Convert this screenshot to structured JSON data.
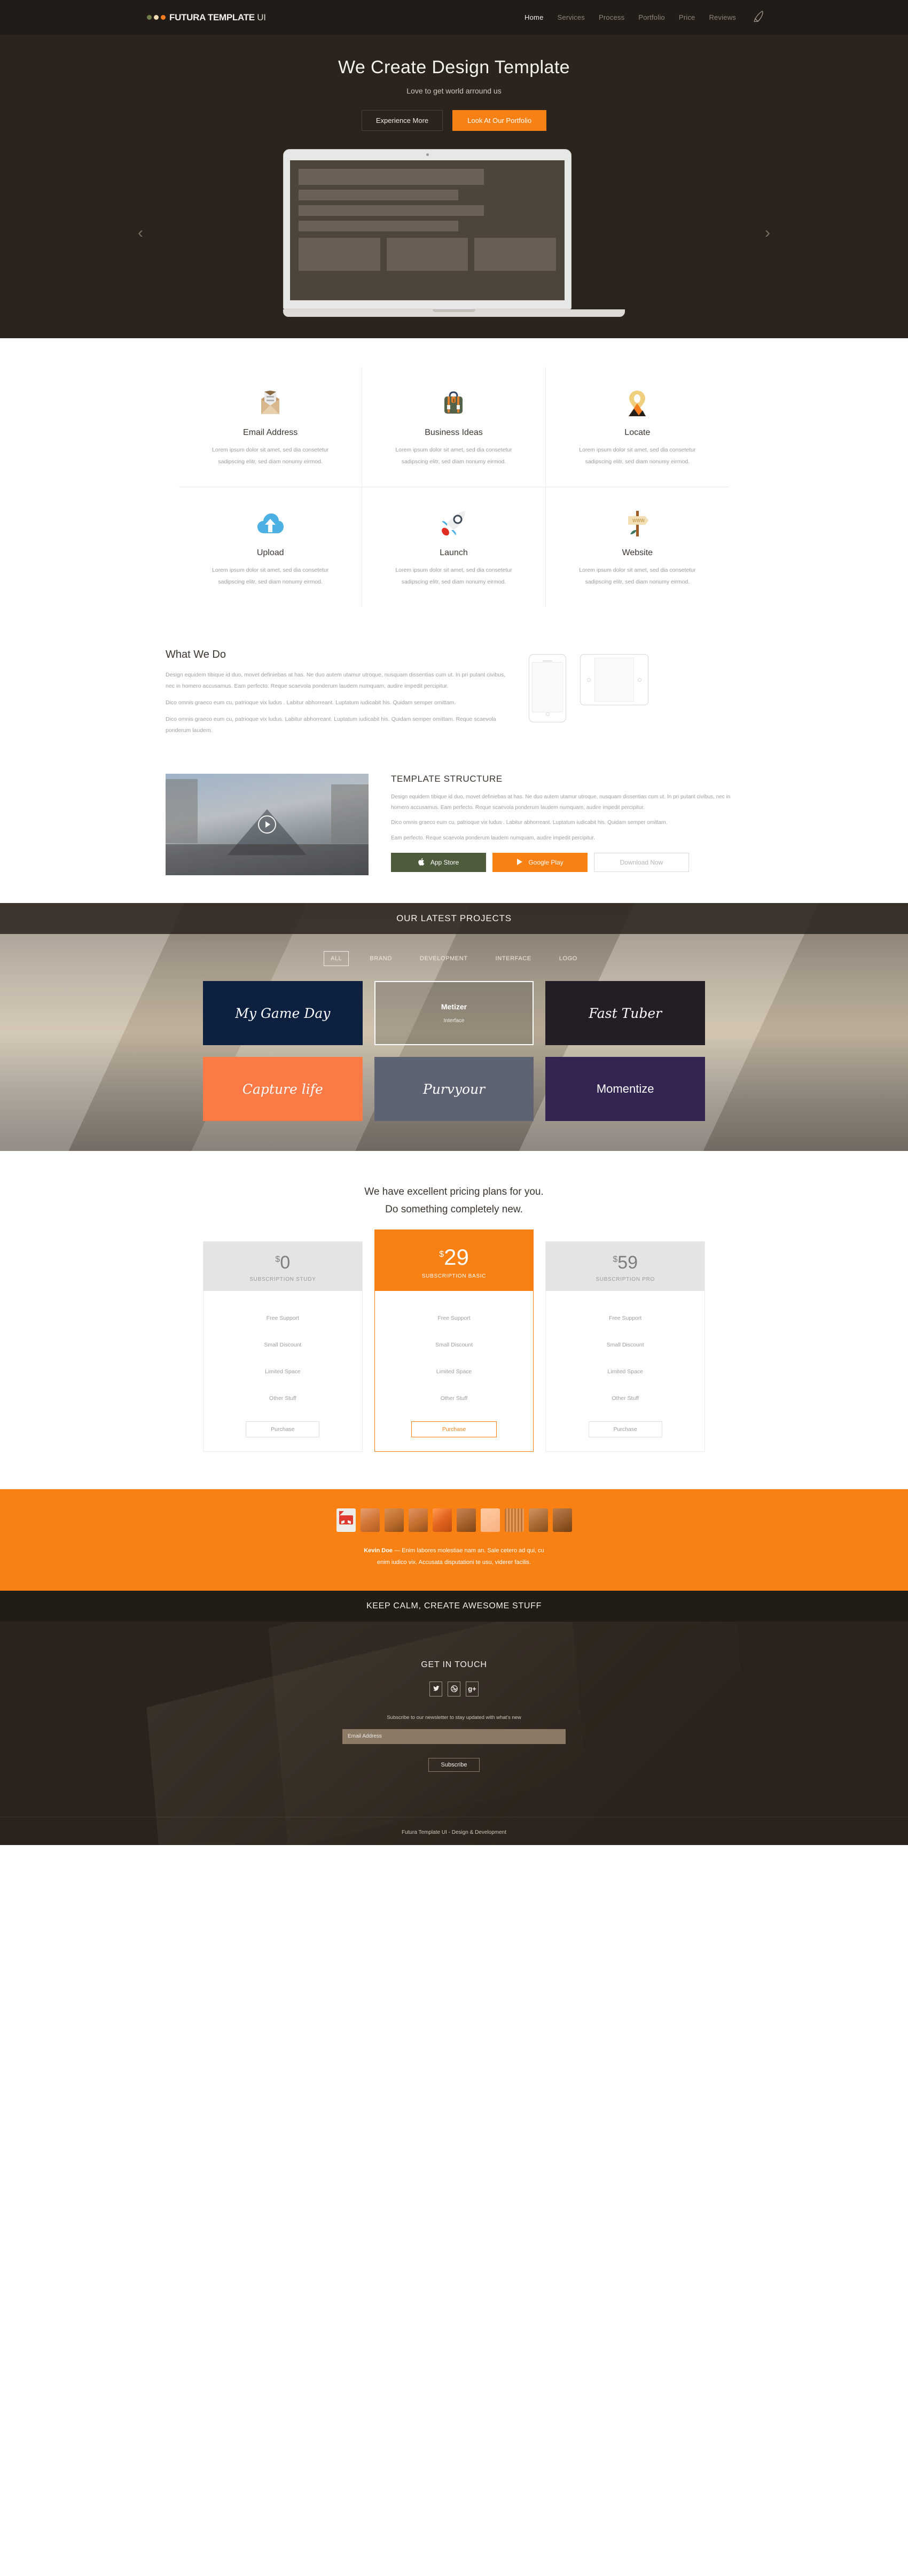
{
  "nav": {
    "brand": "FUTURA TEMPLATE",
    "brand_suffix": "UI",
    "links": [
      {
        "label": "Home",
        "active": true
      },
      {
        "label": "Services",
        "active": false
      },
      {
        "label": "Process",
        "active": false
      },
      {
        "label": "Portfolio",
        "active": false
      },
      {
        "label": "Price",
        "active": false
      },
      {
        "label": "Reviews",
        "active": false
      }
    ],
    "rocket_icon": "rocket-icon"
  },
  "hero": {
    "title": "We Create Design Template",
    "subtitle": "Love to get world arround us",
    "btn_ghost": "Experience More",
    "btn_primary": "Look At Our Portfolio",
    "arrow_prev": "‹",
    "arrow_next": "›"
  },
  "services": {
    "items": [
      {
        "icon": "envelope-icon",
        "title": "Email Address",
        "desc_line1": "Lorem ipsum dolor sit amet,  sed dia  consetetur",
        "desc_line2": "sadipscing elitr, sed diam nonumy eirmod."
      },
      {
        "icon": "briefcase-icon",
        "title": "Business Ideas",
        "desc_line1": "Lorem ipsum dolor sit amet,  sed dia  consetetur",
        "desc_line2": "sadipscing elitr, sed diam nonumy eirmod."
      },
      {
        "icon": "map-pin-icon",
        "title": "Locate",
        "desc_line1": "Lorem ipsum dolor sit amet,  sed dia  consetetur",
        "desc_line2": "sadipscing elitr, sed diam nonumy eirmod."
      },
      {
        "icon": "cloud-upload-icon",
        "title": "Upload",
        "desc_line1": "Lorem ipsum dolor sit amet,  sed dia  consetetur",
        "desc_line2": "sadipscing elitr, sed diam nonumy eirmod."
      },
      {
        "icon": "rocket-icon",
        "title": "Launch",
        "desc_line1": "Lorem ipsum dolor sit amet,  sed dia  consetetur",
        "desc_line2": "sadipscing elitr, sed diam nonumy eirmod."
      },
      {
        "icon": "signpost-www-icon",
        "title": "Website",
        "desc_line1": "Lorem ipsum dolor sit amet,  sed dia  consetetur",
        "desc_line2": "sadipscing elitr, sed diam nonumy eirmod."
      }
    ]
  },
  "what_we_do": {
    "title": "What We Do",
    "p1": "Design equidem tibique id duo, movet definiebas at has. Ne duo autem utamur utroque, nusquam dissentias cum ut. In pri putant civibus, nec in homero accusamus. Eam perfecto. Reque scaevola ponderum laudem numquam, audire impedit percipitur.",
    "p2": "Dico omnis graeco eum cu, patrioque vix ludus . Labitur abhorreant. Luptatum iudicabit his. Quidam semper omittam.",
    "p3": "Dico omnis graeco eum cu, patrioque vix ludus. Labitur abhorreant. Luptatum iudicabit his. Quidam semper omittam. Reque scaevola ponderum laudem."
  },
  "template_structure": {
    "title": "TEMPLATE STRUCTURE",
    "p1": "Design equidem tibique id duo, movet definiebas at has. Ne duo autem utamur utroque, nusquam dissentias cum ut. In pri putant civibus, nec in homero accusamus. Eam perfecto. Reque scaevola ponderum laudem numquam, audire impedit percipitur.",
    "p2": "Dico omnis graeco eum cu, patrioque vix ludus . Labitur abhorreant. Luptatum iudicabit his. Quidam semper omittam.",
    "p3": "Eam perfecto. Reque scaevola ponderum laudem numquam, audire impedit percipitur.",
    "btn_appstore": "App Store",
    "btn_googleplay": "Google Play",
    "btn_download": "Download Now",
    "play_button": "play-icon"
  },
  "portfolio": {
    "title": "OUR LATEST PROJECTS",
    "filters": [
      {
        "label": "ALL",
        "active": true
      },
      {
        "label": "BRAND",
        "active": false
      },
      {
        "label": "DEVELOPMENT",
        "active": false
      },
      {
        "label": "INTERFACE",
        "active": false
      },
      {
        "label": "LOGO",
        "active": false
      }
    ],
    "projects": [
      {
        "name": "My Game Day",
        "category": "",
        "style": "t1"
      },
      {
        "name": "Metizer",
        "category": "Interface",
        "style": "t2"
      },
      {
        "name": "Fast Tuber",
        "category": "",
        "style": "t3"
      },
      {
        "name": "Capture life",
        "category": "",
        "style": "t4"
      },
      {
        "name": "Purvyour",
        "category": "",
        "style": "t5"
      },
      {
        "name": "Momentize",
        "category": "",
        "style": "t6"
      }
    ]
  },
  "pricing": {
    "heading_line1": "We have excellent pricing plans for you.",
    "heading_line2": "Do something completely new.",
    "currency": "$",
    "plans": [
      {
        "amount": "0",
        "plan": "SUBSCRIPTION STUDY",
        "featured": false,
        "features": [
          "Free Support",
          "Small Discount",
          "Limited Space",
          "Other Stuff"
        ],
        "cta": "Purchase"
      },
      {
        "amount": "29",
        "plan": "SUBSCRIPTION BASIC",
        "featured": true,
        "features": [
          "Free Support",
          "Small Discount",
          "Limited Space",
          "Other Stuff"
        ],
        "cta": "Purchase"
      },
      {
        "amount": "59",
        "plan": "SUBSCRIPTION PRO",
        "featured": false,
        "features": [
          "Free Support",
          "Small Discount",
          "Limited Space",
          "Other Stuff"
        ],
        "cta": "Purchase"
      }
    ]
  },
  "testimonial": {
    "author": "Kevin Doe",
    "dash": "—",
    "quote_line1": "Enim labores molestiae nam an. Sale cetero ad qui, cu",
    "quote_line2": "enim iudico vix. Accusata disputationi te usu, viderer facilis.",
    "avatar_count": 10
  },
  "keep_calm": {
    "title": "KEEP CALM, CREATE AWESOME STUFF"
  },
  "contact": {
    "title": "GET IN TOUCH",
    "socials": [
      {
        "icon": "twitter-icon",
        "glyph": "🐦"
      },
      {
        "icon": "dribbble-icon",
        "glyph": "●"
      },
      {
        "icon": "google-plus-icon",
        "glyph": "g+"
      }
    ],
    "newsletter_label": "Subscribe to our newsletter to stay updated with what's new",
    "email_placeholder": "Email Address",
    "email_value": "",
    "btn_subscribe": "Subscribe"
  },
  "footer": {
    "text": "Futura Template UI - Design & Development"
  },
  "colors": {
    "accent_orange": "#f98012",
    "dark_brown": "#221c16",
    "hero_brown": "#2b241d"
  }
}
